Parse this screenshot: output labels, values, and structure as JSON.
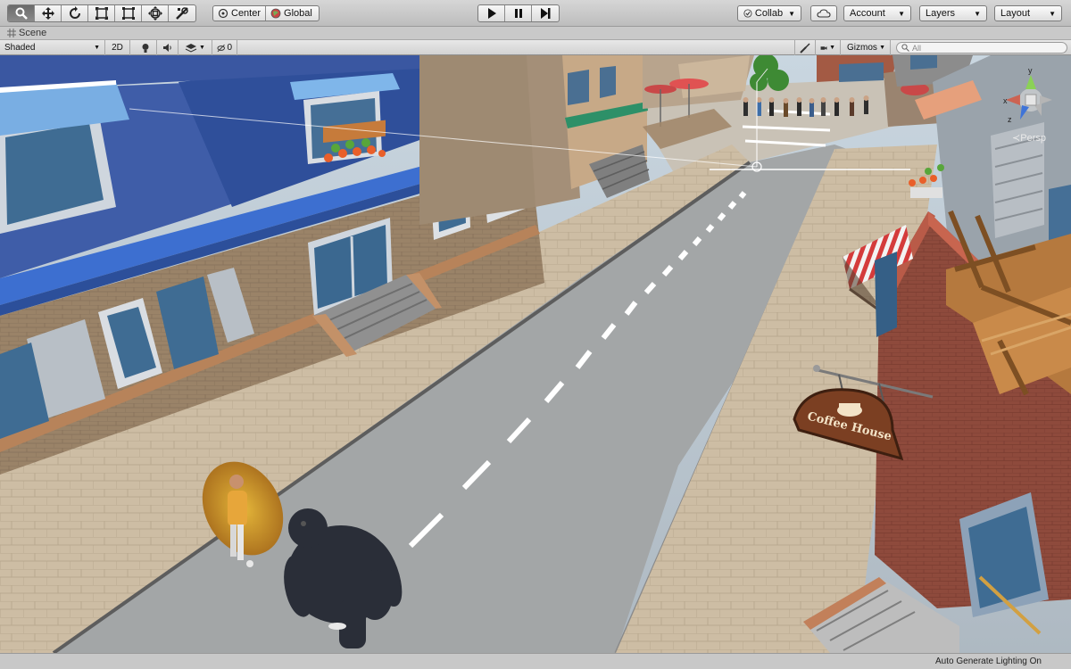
{
  "toolbar": {
    "tools": [
      {
        "name": "hand-tool",
        "active": true
      },
      {
        "name": "move-tool",
        "active": false
      },
      {
        "name": "rotate-tool",
        "active": false
      },
      {
        "name": "scale-tool",
        "active": false
      },
      {
        "name": "rect-tool",
        "active": false
      },
      {
        "name": "transform-tool",
        "active": false
      },
      {
        "name": "custom-tool",
        "active": false
      }
    ],
    "pivot_label": "Center",
    "space_label": "Global",
    "collab_label": "Collab",
    "account_label": "Account",
    "layers_label": "Layers",
    "layout_label": "Layout"
  },
  "scene_tab": {
    "title": "Scene"
  },
  "scene_bar": {
    "shading_mode": "Shaded",
    "mode_2d": "2D",
    "effects_count": "0",
    "gizmos_label": "Gizmos",
    "search_placeholder": "All"
  },
  "viewport": {
    "projection_label": "Persp",
    "sign_text": "Coffee House",
    "axis_labels": {
      "x": "x",
      "y": "y",
      "z": "z"
    }
  },
  "status_bar": {
    "text": "Auto Generate Lighting On"
  }
}
